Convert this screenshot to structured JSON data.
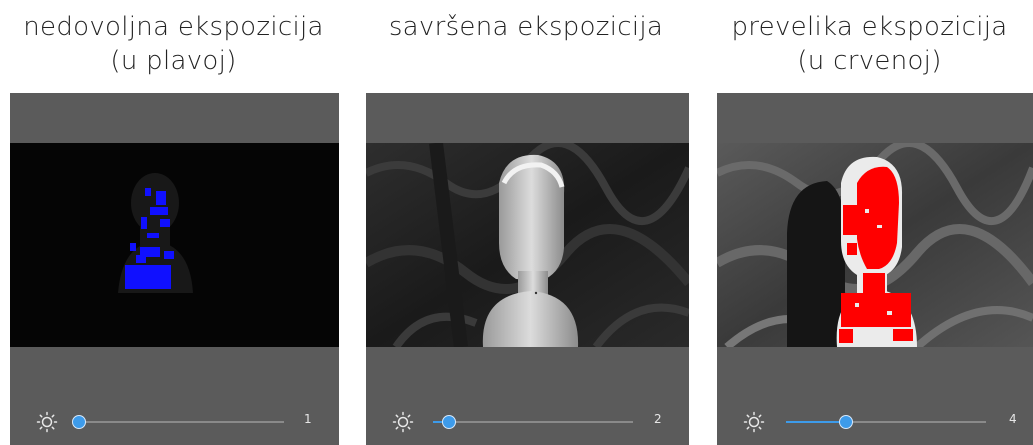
{
  "panels": [
    {
      "caption_line1": "nedovoljna ekspozicija",
      "caption_line2": "(u plavoj)",
      "exposure_value": "1",
      "overlay_color": "#1010ff",
      "slider_fraction": 0.0
    },
    {
      "caption_line1": "savršena ekspozicija",
      "caption_line2": "",
      "exposure_value": "2",
      "overlay_color": "",
      "slider_fraction": 0.08
    },
    {
      "caption_line1": "prevelika ekspozicija",
      "caption_line2": "(u crvenoj)",
      "exposure_value": "4",
      "overlay_color": "#ff0000",
      "slider_fraction": 0.3
    }
  ],
  "icons": {
    "exposure": "sun-brightness-icon"
  },
  "colors": {
    "accent": "#3d9bea",
    "panel_bg": "#5b5b5b"
  }
}
